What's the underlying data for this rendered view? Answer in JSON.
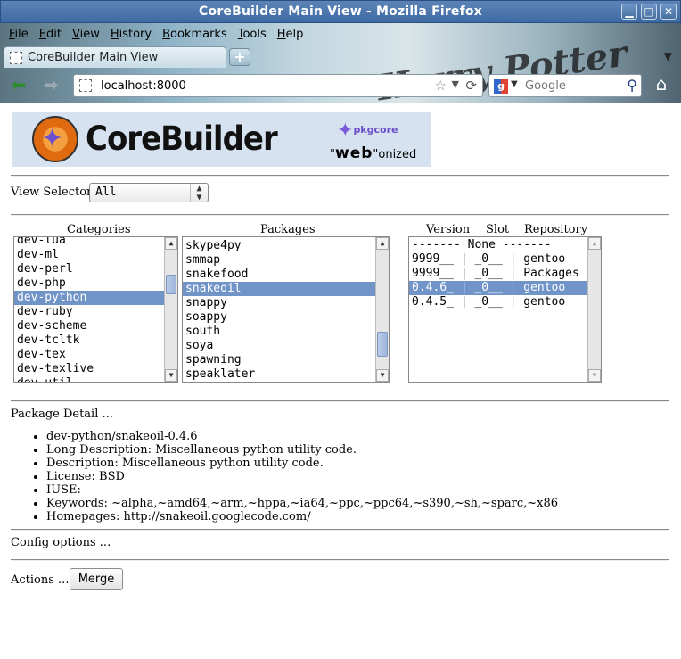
{
  "window": {
    "title": "CoreBuilder Main View - Mozilla Firefox"
  },
  "menubar": {
    "items": [
      {
        "accel": "F",
        "rest": "ile"
      },
      {
        "accel": "E",
        "rest": "dit"
      },
      {
        "accel": "V",
        "rest": "iew"
      },
      {
        "accel": "H",
        "rest": "istory"
      },
      {
        "accel": "B",
        "rest": "ookmarks"
      },
      {
        "accel": "T",
        "rest": "ools"
      },
      {
        "accel": "H",
        "rest": "elp"
      }
    ]
  },
  "tabs": [
    {
      "label": "CoreBuilder Main View",
      "active": true
    }
  ],
  "theme_text": "Harry Potter",
  "navbar": {
    "url": "localhost:8000",
    "search_placeholder": "Google",
    "search_engine_letter": "g"
  },
  "banner": {
    "brand": "CoreBuilder",
    "pkgcore": "pkgcore",
    "web_prefix": "\"",
    "web": "web",
    "web_suffix": "\"onized"
  },
  "view_selector": {
    "label": "View Selector",
    "value": "All"
  },
  "columns": {
    "categories": "Categories",
    "packages": "Packages",
    "version": "Version",
    "slot": "Slot",
    "repository": "Repository"
  },
  "categories": {
    "items": [
      "dev-lua",
      "dev-ml",
      "dev-perl",
      "dev-php",
      "dev-python",
      "dev-ruby",
      "dev-scheme",
      "dev-tcltk",
      "dev-tex",
      "dev-texlive",
      "dev-util"
    ],
    "selected": "dev-python",
    "scroll_fraction": 0.55
  },
  "packages": {
    "items": [
      "skype4py",
      "smmap",
      "snakefood",
      "snakeoil",
      "snappy",
      "soappy",
      "south",
      "soya",
      "spawning",
      "speaklater"
    ],
    "selected": "snakeoil",
    "scroll_fraction": 0.88
  },
  "versions": {
    "items": [
      "------- None -------",
      "9999__ | _0__ | gentoo",
      "9999__ | _0__ | Packages",
      "0.4.6_ | _0__ | gentoo",
      "0.4.5_ | _0__ | gentoo"
    ],
    "selected": "0.4.6_ | _0__ | gentoo"
  },
  "package_detail": {
    "title": "Package Detail ...",
    "lines": [
      "dev-python/snakeoil-0.4.6",
      "Long Description: Miscellaneous python utility code.",
      "Description: Miscellaneous python utility code.",
      "License: BSD",
      "IUSE:",
      "Keywords: ~alpha,~amd64,~arm,~hppa,~ia64,~ppc,~ppc64,~s390,~sh,~sparc,~x86",
      "Homepages: http://snakeoil.googlecode.com/"
    ]
  },
  "config": {
    "title": "Config options ..."
  },
  "actions": {
    "title": "Actions ...",
    "merge_label": "Merge"
  }
}
